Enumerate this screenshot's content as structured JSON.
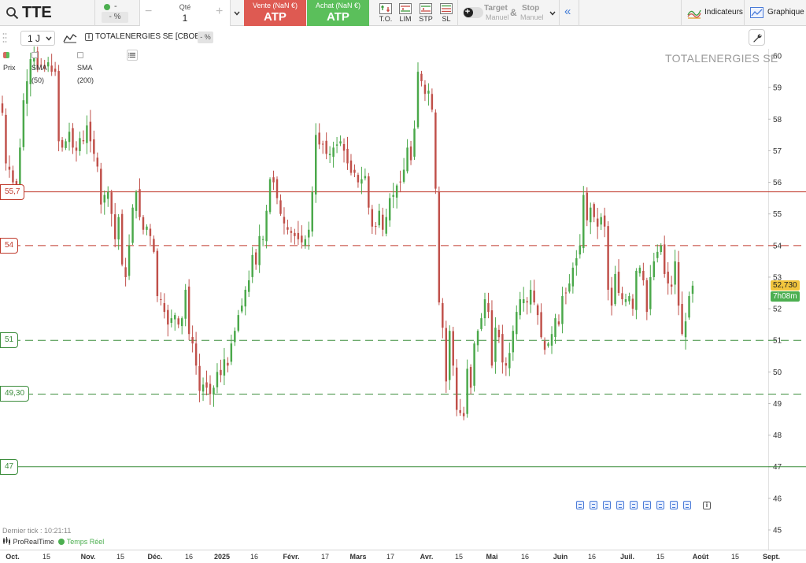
{
  "toolbar": {
    "ticker": "TTE",
    "change_value": "-",
    "change_pct": "- %",
    "qty_label": "Qté",
    "qty_value": "1",
    "qty_minus": "−",
    "qty_plus": "+",
    "sell_label": "Vente (NaN €)",
    "sell_value": "ATP",
    "buy_label": "Achat (NaN €)",
    "buy_value": "ATP",
    "order_types": [
      {
        "label": "T.O.",
        "icon": "market-order-icon"
      },
      {
        "label": "LIM",
        "icon": "limit-order-icon"
      },
      {
        "label": "STP",
        "icon": "stop-order-icon"
      },
      {
        "label": "SL",
        "icon": "stop-limit-order-icon"
      }
    ],
    "target_label": "Target",
    "target_sub": "Manuel",
    "amp": "&",
    "stop_label": "Stop",
    "stop_sub": "Manuel",
    "collapse_glyph": "«",
    "indicators_label": "Indicateurs",
    "graph_label": "Graphique",
    "colors": {
      "sell": "#de5a52",
      "buy": "#5bbf5b",
      "accent": "#3f7ad6"
    }
  },
  "chart_header": {
    "period": "1 J",
    "instrument": "TOTALENERGIES SE [CBOE]",
    "change_pct": "- %",
    "legend": [
      {
        "label": "Prix",
        "active": true
      },
      {
        "label": "SMA (50)",
        "active": false
      },
      {
        "label": "SMA (200)",
        "active": false
      }
    ],
    "watermark": "TOTALENERGIES SE"
  },
  "footer": {
    "last_tick": "Dernier tick : 10:21:11",
    "source": "ProRealTime",
    "realtime": "Temps Réel"
  },
  "chart_data": {
    "type": "candlestick",
    "y_axis": {
      "min": 45,
      "max": 60,
      "ticks": [
        "45",
        "46",
        "47",
        "48",
        "49",
        "50",
        "51",
        "52",
        "53",
        "54",
        "55",
        "56",
        "57",
        "58",
        "59",
        "60"
      ]
    },
    "x_axis_labels": [
      {
        "label": "Oct.",
        "bold": true
      },
      {
        "label": "15",
        "bold": false
      },
      {
        "label": "Nov.",
        "bold": true
      },
      {
        "label": "15",
        "bold": false
      },
      {
        "label": "Déc.",
        "bold": true
      },
      {
        "label": "16",
        "bold": false
      },
      {
        "label": "2025",
        "bold": true
      },
      {
        "label": "16",
        "bold": false
      },
      {
        "label": "Févr.",
        "bold": true
      },
      {
        "label": "17",
        "bold": false
      },
      {
        "label": "Mars",
        "bold": true
      },
      {
        "label": "17",
        "bold": false
      },
      {
        "label": "Avr.",
        "bold": true
      },
      {
        "label": "15",
        "bold": false
      },
      {
        "label": "Mai",
        "bold": true
      },
      {
        "label": "16",
        "bold": false
      },
      {
        "label": "Juin",
        "bold": true
      },
      {
        "label": "16",
        "bold": false
      },
      {
        "label": "Juil.",
        "bold": true
      },
      {
        "label": "15",
        "bold": false
      },
      {
        "label": "Août",
        "bold": true
      },
      {
        "label": "15",
        "bold": false
      },
      {
        "label": "Sept.",
        "bold": true
      }
    ],
    "levels": [
      {
        "value": 55.7,
        "label": "55,7",
        "color": "#c0392b",
        "style": "solid"
      },
      {
        "value": 54,
        "label": "54",
        "color": "#c0392b",
        "style": "dashed"
      },
      {
        "value": 51,
        "label": "51",
        "color": "#3c8d3c",
        "style": "dashed"
      },
      {
        "value": 49.3,
        "label": "49,30",
        "color": "#3c8d3c",
        "style": "dashed"
      },
      {
        "value": 47,
        "label": "47",
        "color": "#3c8d3c",
        "style": "solid"
      }
    ],
    "last_price": {
      "value": 52.73,
      "label": "52,730"
    },
    "countdown": "7h08m",
    "closes": [
      58.2,
      56.6,
      56.4,
      56.0,
      55.9,
      57.1,
      58.6,
      59.2,
      59.9,
      60.1,
      59.6,
      59.7,
      59.6,
      59.8,
      59.5,
      59.5,
      57.3,
      57.1,
      57.3,
      57.6,
      57.1,
      57.0,
      57.4,
      57.3,
      57.8,
      57.3,
      56.9,
      56.5,
      55.3,
      55.6,
      55.7,
      55.0,
      54.2,
      54.9,
      53.4,
      53.0,
      54.0,
      55.2,
      55.7,
      54.9,
      54.5,
      54.6,
      54.3,
      53.8,
      52.4,
      52.3,
      51.9,
      51.5,
      51.7,
      51.8,
      51.5,
      51.7,
      52.6,
      51.2,
      50.9,
      50.2,
      49.4,
      49.6,
      49.5,
      49.3,
      49.5,
      50.0,
      49.9,
      50.4,
      50.2,
      50.9,
      51.3,
      51.8,
      52.1,
      52.6,
      52.9,
      53.7,
      53.4,
      54.3,
      54.2,
      55.1,
      56.1,
      56.0,
      55.5,
      55.0,
      54.7,
      54.5,
      54.4,
      54.3,
      54.2,
      54.1,
      54.2,
      54.5,
      55.7,
      57.5,
      57.2,
      57.2,
      56.9,
      56.9,
      57.1,
      57.2,
      57.3,
      57.0,
      56.6,
      56.3,
      56.3,
      56.0,
      56.1,
      56.2,
      55.2,
      54.6,
      54.6,
      55.1,
      54.5,
      54.9,
      55.5,
      55.6,
      55.9,
      56.0,
      56.4,
      57.1,
      56.7,
      57.7,
      59.5,
      59.2,
      58.8,
      58.9,
      58.3,
      55.8,
      52.2,
      51.4,
      49.7,
      51.3,
      50.2,
      48.8,
      48.7,
      48.6,
      50.1,
      49.5,
      50.9,
      51.3,
      51.7,
      52.3,
      51.9,
      50.2,
      51.4,
      51.1,
      50.3,
      50.2,
      50.6,
      51.3,
      51.9,
      52.3,
      52.3,
      52.2,
      52.6,
      52.2,
      51.8,
      51.1,
      50.7,
      50.9,
      51.2,
      51.7,
      51.5,
      52.4,
      52.5,
      52.8,
      53.3,
      53.6,
      54.0,
      55.6,
      54.8,
      55.2,
      54.9,
      54.6,
      54.9,
      54.6,
      52.6,
      52.1,
      53.1,
      52.5,
      52.3,
      52.3,
      52.4,
      52.0,
      53.2,
      53.3,
      52.9,
      51.9,
      53.0,
      53.5,
      53.8,
      54.0,
      53.1,
      52.8,
      52.7,
      53.5,
      52.1,
      51.2,
      51.6,
      52.4,
      52.73
    ]
  }
}
